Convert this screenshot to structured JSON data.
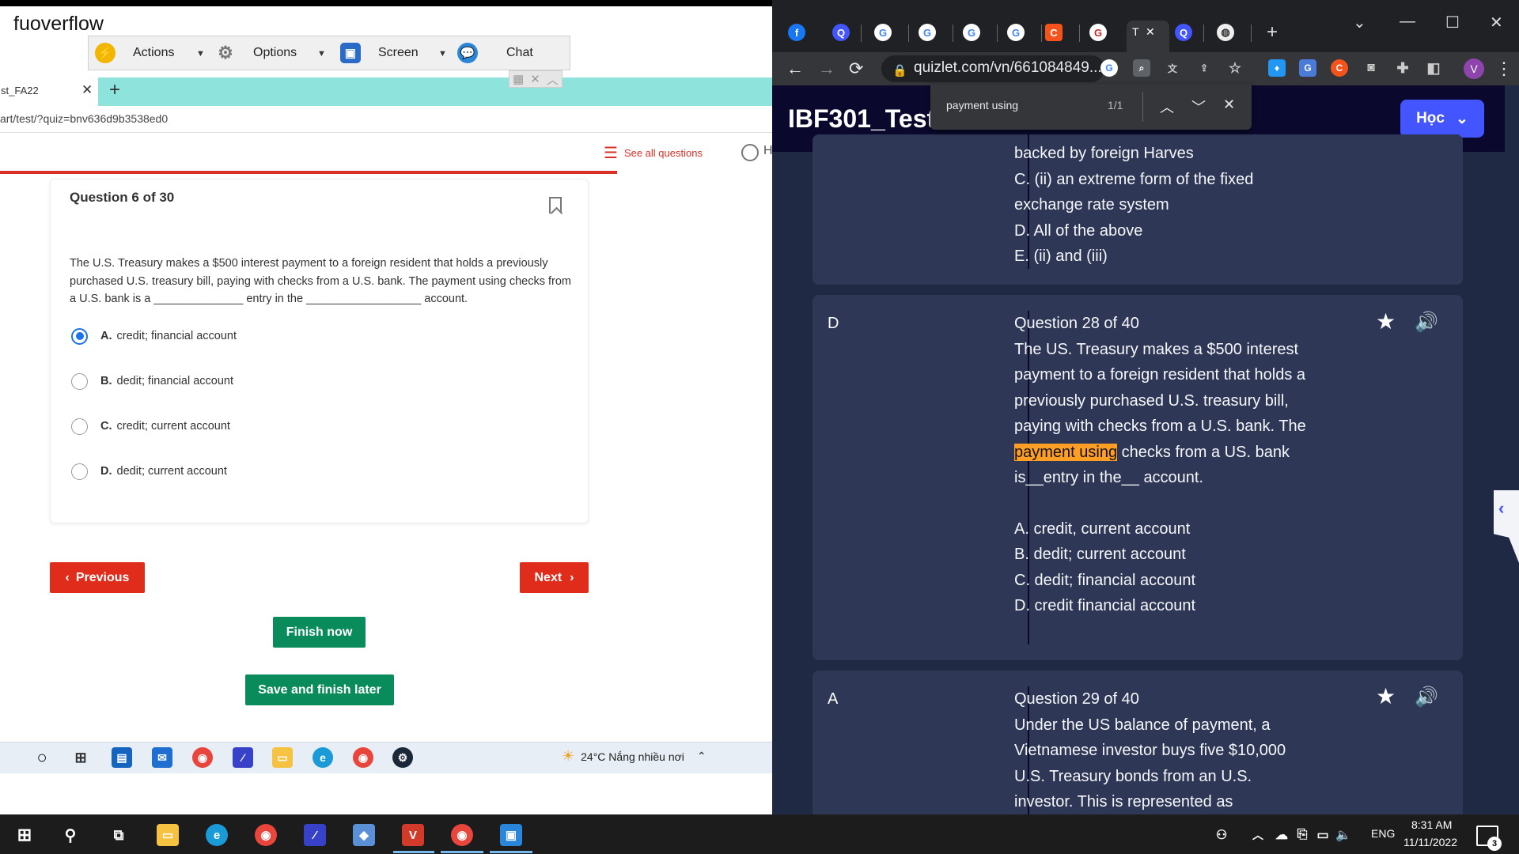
{
  "remote": {
    "window_title": "fuoverflow",
    "toolbar": {
      "actions": "Actions",
      "options": "Options",
      "screen": "Screen",
      "chat": "Chat"
    },
    "inner_browser": {
      "tab_label": "st_FA22",
      "url": "art/test/?quiz=bnv636d9b3538ed0"
    },
    "see_all_questions": "See all questions",
    "user_initial": "H",
    "question": {
      "number": "Question 6 of 30",
      "text": "The U.S. Treasury makes a $500 interest payment to a foreign resident that holds a previously purchased U.S. treasury bill, paying with checks from a U.S. bank. The payment using checks from a U.S. bank is a ______________ entry in the __________________ account.",
      "options": [
        {
          "letter": "A.",
          "text": "credit; financial account",
          "selected": true
        },
        {
          "letter": "B.",
          "text": "dedit; financial account",
          "selected": false
        },
        {
          "letter": "C.",
          "text": "credit; current account",
          "selected": false
        },
        {
          "letter": "D.",
          "text": "dedit; current account",
          "selected": false
        }
      ]
    },
    "buttons": {
      "previous": "Previous",
      "next": "Next",
      "finish": "Finish now",
      "save_finish": "Save and finish later"
    },
    "taskbar": {
      "weather": "24°C  Nắng nhiều nơi"
    }
  },
  "chrome": {
    "url": "quizlet.com/vn/661084849...",
    "profile_initial": "V",
    "active_tab_label": "T",
    "find": {
      "query": "payment using",
      "count": "1/1"
    }
  },
  "quizlet": {
    "set_title": "IBF301_Test1",
    "study_button": "Học",
    "cards": [
      {
        "answer": "",
        "text": "backed by foreign Harves\nC. (ii) an extreme form of the fixed\nexchange rate system\nD. All of the above\nE. (ii) and (iii)"
      },
      {
        "answer": "D",
        "question_num": "Question 28 of 40",
        "text_before": "The US. Treasury makes a $500 interest payment to a foreign resident that holds a previously purchased U.S. treasury bill, paying with checks from a U.S. bank. The ",
        "highlight": "payment using",
        "text_after": " checks from a US. bank is__entry in the__ account.",
        "options": [
          "A. credit, current account",
          "B. dedit; current account",
          "C. dedit; financial account",
          "D. credit financial account"
        ]
      },
      {
        "answer": "A",
        "question_num": "Question 29 of 40",
        "text": "Under the US balance of payment, a Vietnamese investor buys five $10,000 U.S. Treasury bonds from an U.S. investor. This is represented as"
      }
    ]
  },
  "taskbar": {
    "lang": "ENG",
    "time": "8:31 AM",
    "date": "11/11/2022",
    "notifications": "3"
  },
  "colors": {
    "quizlet_bg": "#1f2944",
    "quizlet_card": "#2e3856",
    "quizlet_blue": "#4255ff",
    "highlight": "#ff9e24",
    "exam_red": "#e02d1b",
    "exam_green": "#0a8b5c",
    "inner_tabbar": "#8fe3dd"
  }
}
